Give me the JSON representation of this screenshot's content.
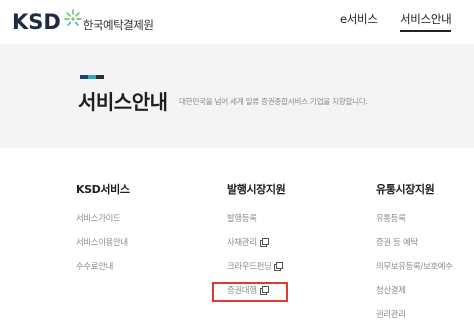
{
  "header": {
    "logo_ksd": "KSD",
    "logo_name": "한국예탁결제원",
    "nav": {
      "eservice": "e서비스",
      "service_guide": "서비스안내"
    }
  },
  "banner": {
    "title": "서비스안내",
    "description": "대한민국을 넘어 세계 일류 증권종합서비스 기업을 지향합니다.",
    "accent_colors": [
      "#1f3f6e",
      "#2aa6c8",
      "#2d2d2d"
    ]
  },
  "columns": [
    {
      "title": "KSD서비스",
      "items": [
        {
          "label": "서비스가이드",
          "external": false
        },
        {
          "label": "서비스이용안내",
          "external": false
        },
        {
          "label": "수수료안내",
          "external": false
        }
      ]
    },
    {
      "title": "발행시장지원",
      "items": [
        {
          "label": "발행등록",
          "external": false
        },
        {
          "label": "사채관리",
          "external": true
        },
        {
          "label": "크라우드펀딩",
          "external": true
        },
        {
          "label": "증권대행",
          "external": true
        }
      ]
    },
    {
      "title": "유통시장지원",
      "items": [
        {
          "label": "유통등록",
          "external": false
        },
        {
          "label": "증권 등 예탁",
          "external": false
        },
        {
          "label": "의무보유등록/보호예수",
          "external": false
        },
        {
          "label": "청산결제",
          "external": false
        },
        {
          "label": "권리관리",
          "external": false
        }
      ]
    }
  ],
  "highlight_color": "#e03a2e"
}
